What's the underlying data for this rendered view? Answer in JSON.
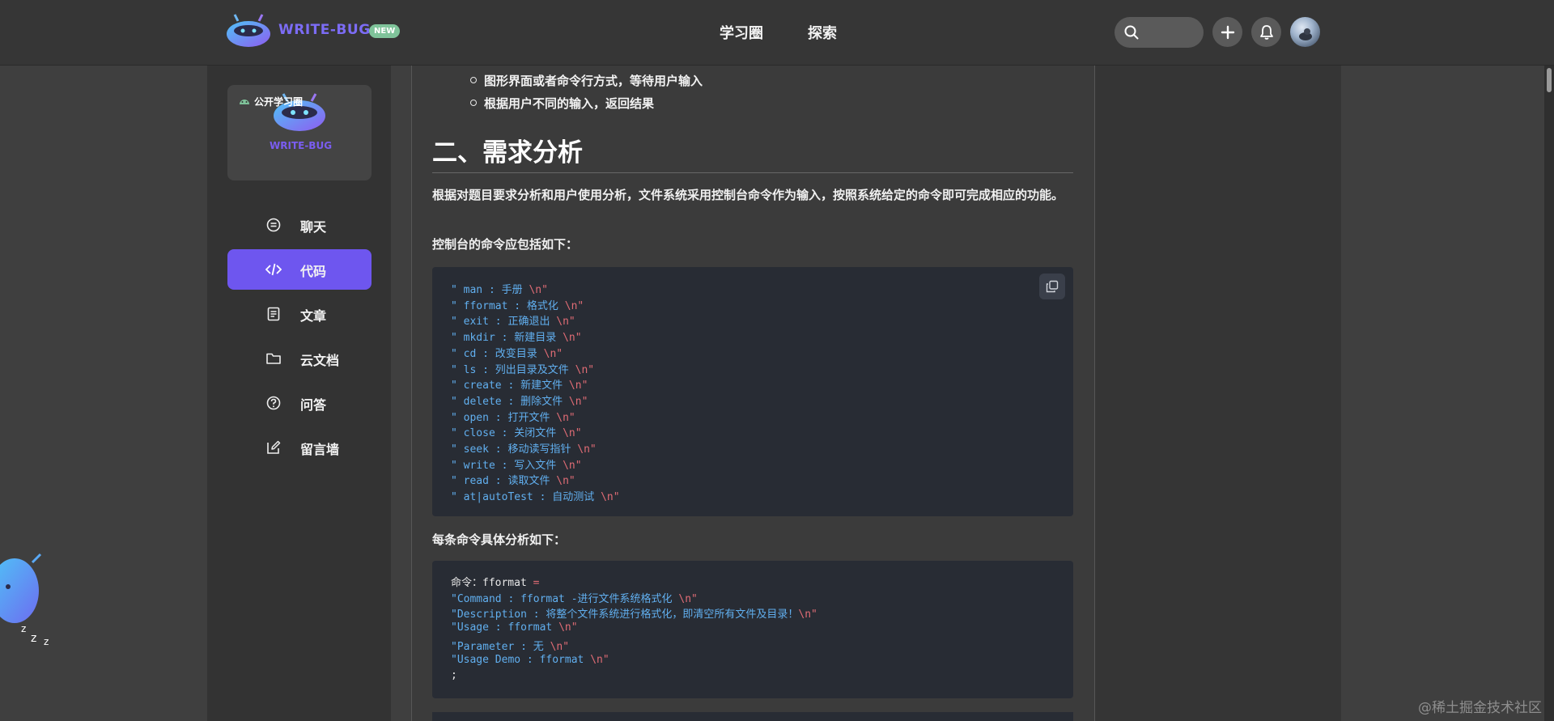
{
  "header": {
    "brand": "WRITE-BUG",
    "badge": "NEW",
    "nav": [
      "学习圈",
      "探索"
    ]
  },
  "sidebar": {
    "community": {
      "label": "公开学习圈",
      "brand": "WRITE-BUG"
    },
    "items": [
      {
        "label": "聊天",
        "icon": "chat-icon"
      },
      {
        "label": "代码",
        "icon": "code-icon",
        "active": true
      },
      {
        "label": "文章",
        "icon": "article-icon"
      },
      {
        "label": "云文档",
        "icon": "folder-icon"
      },
      {
        "label": "问答",
        "icon": "question-icon"
      },
      {
        "label": "留言墙",
        "icon": "edit-icon"
      }
    ]
  },
  "article": {
    "bullets": [
      "图形界面或者命令行方式，等待用户输入",
      "根据用户不同的输入，返回结果"
    ],
    "heading": "二、需求分析",
    "para1": "根据对题目要求分析和用户使用分析，文件系统采用控制台命令作为输入，按照系统给定的命令即可完成相应的功能。",
    "para2": "控制台的命令应包括如下：",
    "code1": [
      {
        "text": "\" man : 手册 ",
        "esc": "\\n\"",
        "tail": ""
      },
      {
        "text": "\" fformat : 格式化 ",
        "esc": "\\n\"",
        "tail": ""
      },
      {
        "text": "\" exit : 正确退出 ",
        "esc": "\\n\"",
        "tail": ""
      },
      {
        "text": "\" mkdir : 新建目录 ",
        "esc": "\\n\"",
        "tail": ""
      },
      {
        "text": "\" cd : 改变目录 ",
        "esc": "\\n\"",
        "tail": ""
      },
      {
        "text": "\" ls : 列出目录及文件 ",
        "esc": "\\n\"",
        "tail": ""
      },
      {
        "text": "\" create : 新建文件 ",
        "esc": "\\n\"",
        "tail": ""
      },
      {
        "text": "\" delete : 删除文件 ",
        "esc": "\\n\"",
        "tail": ""
      },
      {
        "text": "\" open : 打开文件 ",
        "esc": "\\n\"",
        "tail": ""
      },
      {
        "text": "\" close : 关闭文件 ",
        "esc": "\\n\"",
        "tail": ""
      },
      {
        "text": "\" seek : 移动读写指针 ",
        "esc": "\\n\"",
        "tail": ""
      },
      {
        "text": "\" write : 写入文件 ",
        "esc": "\\n\"",
        "tail": ""
      },
      {
        "text": "\" read : 读取文件 ",
        "esc": "\\n\"",
        "tail": ""
      },
      {
        "text": "\" at|autoTest : 自动测试 ",
        "esc": "\\n\"",
        "tail": ""
      }
    ],
    "para3": "每条命令具体分析如下：",
    "code2": [
      {
        "text": "命令：fformat ",
        "esc": "=",
        "tail": "",
        "white": true
      },
      {
        "text": "\"Command : fformat -进行文件系统格式化 ",
        "esc": "\\n\"",
        "tail": ""
      },
      {
        "text": "\"Description : 将整个文件系统进行格式化，即清空所有文件及目录！",
        "esc": "\\n\"",
        "tail": ""
      },
      {
        "text": "\"Usage : fformat ",
        "esc": "\\n\"",
        "tail": ""
      },
      {
        "text": "\"Parameter : 无 ",
        "esc": "\\n\"",
        "tail": ""
      },
      {
        "text": "\"Usage Demo : fformat ",
        "esc": "\\n\"",
        "tail": ""
      },
      {
        "text": ";",
        "esc": "",
        "tail": "",
        "white": true
      }
    ]
  },
  "watermark": "@稀土掘金技术社区",
  "colors": {
    "accent": "#6e56ef",
    "code_bg": "#282c34",
    "code_text": "#61afef",
    "code_escape": "#e06c75"
  }
}
